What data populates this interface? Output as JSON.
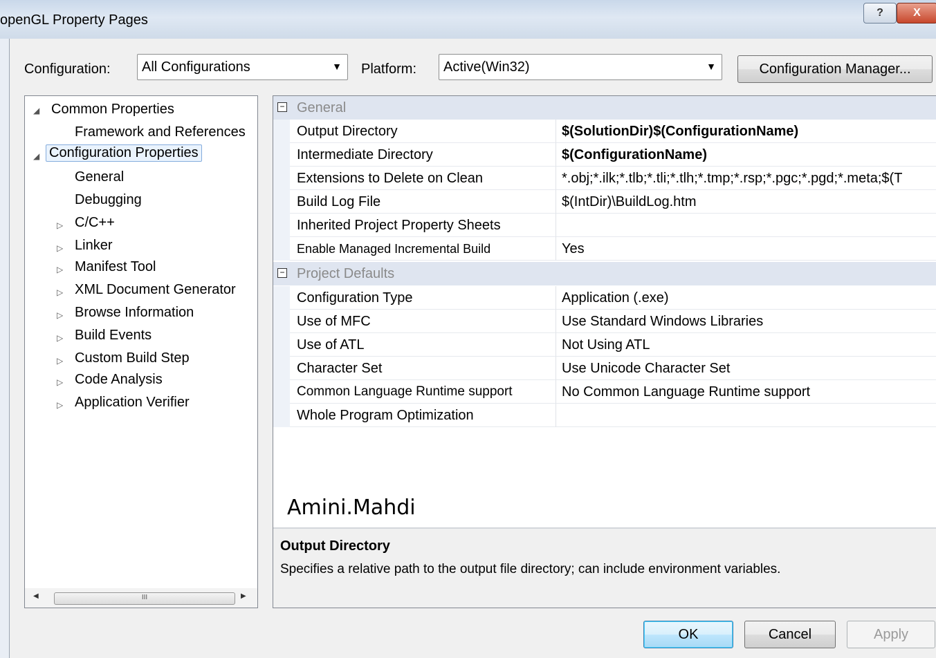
{
  "window": {
    "title": "openGL Property Pages",
    "help_glyph": "?",
    "close_glyph": "X"
  },
  "toolbar": {
    "configuration_label": "Configuration:",
    "configuration_value": "All Configurations",
    "platform_label": "Platform:",
    "platform_value": "Active(Win32)",
    "config_manager_label": "Configuration Manager...",
    "dropdown_glyph": "▼"
  },
  "tree": {
    "expanded_glyph": "◢",
    "collapsed_glyph": "▷",
    "items": [
      {
        "label": "Common Properties"
      },
      {
        "label": "Framework and References"
      },
      {
        "label": "Configuration Properties"
      },
      {
        "label": "General"
      },
      {
        "label": "Debugging"
      },
      {
        "label": "C/C++"
      },
      {
        "label": "Linker"
      },
      {
        "label": "Manifest Tool"
      },
      {
        "label": "XML Document Generator"
      },
      {
        "label": "Browse Information"
      },
      {
        "label": "Build Events"
      },
      {
        "label": "Custom Build Step"
      },
      {
        "label": "Code Analysis"
      },
      {
        "label": "Application Verifier"
      }
    ],
    "scroll_thumb": "III",
    "scroll_left": "◀",
    "scroll_right": "▶"
  },
  "grid": {
    "collapse_glyph": "−",
    "categories": [
      {
        "title": "General",
        "rows": [
          {
            "name": "Output Directory",
            "value": "$(SolutionDir)$(ConfigurationName)"
          },
          {
            "name": "Intermediate Directory",
            "value": "$(ConfigurationName)"
          },
          {
            "name": "Extensions to Delete on Clean",
            "value": "*.obj;*.ilk;*.tlb;*.tli;*.tlh;*.tmp;*.rsp;*.pgc;*.pgd;*.meta;$(T"
          },
          {
            "name": "Build Log File",
            "value": "$(IntDir)\\BuildLog.htm"
          },
          {
            "name": "Inherited Project Property Sheets",
            "value": ""
          },
          {
            "name": "Enable Managed Incremental Build",
            "value": "Yes"
          }
        ]
      },
      {
        "title": "Project Defaults",
        "rows": [
          {
            "name": "Configuration Type",
            "value": "Application (.exe)"
          },
          {
            "name": "Use of MFC",
            "value": "Use Standard Windows Libraries"
          },
          {
            "name": "Use of ATL",
            "value": "Not Using ATL"
          },
          {
            "name": "Character Set",
            "value": "Use Unicode Character Set"
          },
          {
            "name": "Common Language Runtime support",
            "value": "No Common Language Runtime support"
          },
          {
            "name": "Whole Program Optimization",
            "value": ""
          }
        ]
      }
    ]
  },
  "watermark": "Amini.Mahdi",
  "description": {
    "title": "Output Directory",
    "text": "Specifies a relative path to the output file directory; can include environment variables."
  },
  "buttons": {
    "ok": "OK",
    "cancel": "Cancel",
    "apply": "Apply"
  }
}
